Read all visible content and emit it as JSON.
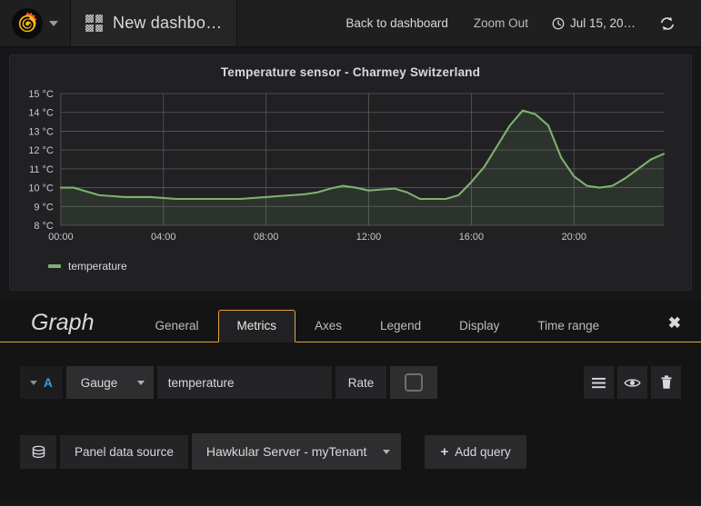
{
  "navbar": {
    "logo_icon": "grafana-logo-icon",
    "logo_caret_icon": "chevron-down-icon",
    "dashboard_icon": "dashboard-grid-icon",
    "dashboard_title": "New dashbo…",
    "back_to_dashboard": "Back to dashboard",
    "zoom_out": "Zoom Out",
    "clock_icon": "clock-icon",
    "time_range": "Jul 15, 20…",
    "refresh_icon": "refresh-icon"
  },
  "panel": {
    "title": "Temperature sensor - Charmey Switzerland",
    "legend": [
      {
        "label": "temperature",
        "color": "#7eb26d"
      }
    ]
  },
  "chart_data": {
    "type": "area",
    "title": "Temperature sensor - Charmey Switzerland",
    "xlabel": "",
    "ylabel": "",
    "unit": "°C",
    "grid": true,
    "legend_position": "bottom-left",
    "line_color": "#7eb26d",
    "fill_color": "rgba(126,178,109,0.12)",
    "ylim": [
      8,
      15
    ],
    "yticks": [
      "8 °C",
      "9 °C",
      "10 °C",
      "11 °C",
      "12 °C",
      "13 °C",
      "14 °C",
      "15 °C"
    ],
    "ytick_values": [
      8,
      9,
      10,
      11,
      12,
      13,
      14,
      15
    ],
    "xticks": [
      "00:00",
      "04:00",
      "08:00",
      "12:00",
      "16:00",
      "20:00"
    ],
    "xtick_hours": [
      0,
      4,
      8,
      12,
      16,
      20
    ],
    "xlim": [
      0,
      23.5
    ],
    "series": [
      {
        "name": "temperature",
        "color": "#7eb26d",
        "x": [
          0,
          0.5,
          1,
          1.5,
          2,
          2.5,
          3,
          3.5,
          4,
          4.5,
          5,
          5.5,
          6,
          6.5,
          7,
          7.5,
          8,
          8.5,
          9,
          9.5,
          10,
          10.5,
          11,
          11.5,
          12,
          12.5,
          13,
          13.5,
          14,
          14.5,
          15,
          15.5,
          16,
          16.5,
          17,
          17.5,
          18,
          18.5,
          19,
          19.5,
          20,
          20.5,
          21,
          21.5,
          22,
          22.5,
          23,
          23.5
        ],
        "values": [
          10.0,
          10.0,
          9.8,
          9.6,
          9.55,
          9.5,
          9.5,
          9.5,
          9.45,
          9.4,
          9.4,
          9.4,
          9.4,
          9.4,
          9.4,
          9.45,
          9.5,
          9.55,
          9.6,
          9.65,
          9.75,
          9.95,
          10.1,
          10.0,
          9.85,
          9.9,
          9.95,
          9.75,
          9.4,
          9.4,
          9.4,
          9.6,
          10.3,
          11.1,
          12.2,
          13.3,
          14.1,
          13.9,
          13.3,
          11.6,
          10.6,
          10.1,
          10.0,
          10.1,
          10.5,
          11.0,
          11.5,
          11.8
        ]
      }
    ]
  },
  "editor": {
    "kind": "Graph",
    "tabs": [
      {
        "label": "General",
        "active": false
      },
      {
        "label": "Metrics",
        "active": true
      },
      {
        "label": "Axes",
        "active": false
      },
      {
        "label": "Legend",
        "active": false
      },
      {
        "label": "Display",
        "active": false
      },
      {
        "label": "Time range",
        "active": false
      }
    ],
    "close_icon": "close-icon",
    "query": {
      "collapse_icon": "chevron-down-icon",
      "ref_id": "A",
      "ref_color": "#33a2e5",
      "type_select": "Gauge",
      "type_caret_icon": "chevron-down-icon",
      "metric_value": "temperature",
      "metric_placeholder": "",
      "rate_label": "Rate",
      "rate_checked": false,
      "actions": [
        {
          "icon": "hamburger-menu-icon",
          "name": "query-options-button"
        },
        {
          "icon": "eye-icon",
          "name": "toggle-query-visibility-button"
        },
        {
          "icon": "trash-icon",
          "name": "delete-query-button"
        }
      ]
    },
    "datasource": {
      "icon": "database-icon",
      "label": "Panel data source",
      "selected": "Hawkular Server - myTenant",
      "caret_icon": "chevron-down-icon"
    },
    "add_query": {
      "plus": "+",
      "label": "Add query"
    }
  }
}
